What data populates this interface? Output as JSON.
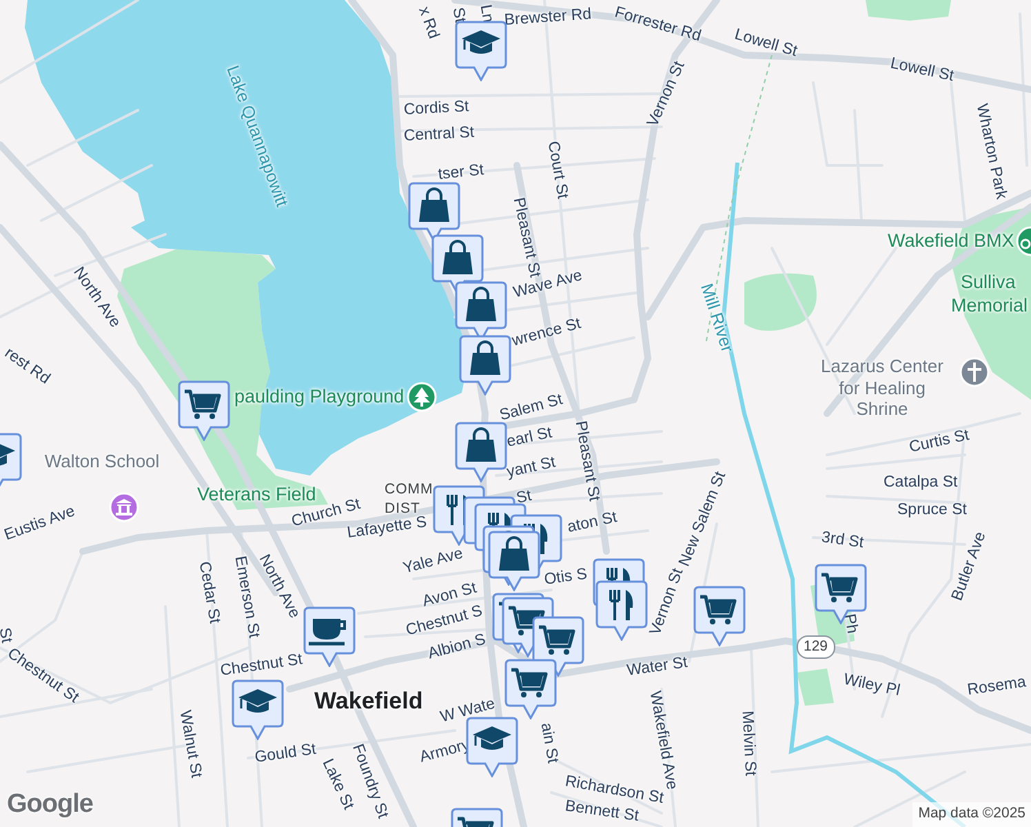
{
  "map": {
    "labels": [
      {
        "kind": "street",
        "text": "x Rd"
      },
      {
        "kind": "street",
        "text": "St"
      },
      {
        "kind": "street",
        "text": "Ln"
      },
      {
        "kind": "street",
        "text": "Brewster Rd"
      },
      {
        "kind": "street",
        "text": "Forrester Rd"
      },
      {
        "kind": "street",
        "text": "Lowell St"
      },
      {
        "kind": "street",
        "text": "Lowell St"
      },
      {
        "kind": "water",
        "text": "Lake Quannapowitt"
      },
      {
        "kind": "street",
        "text": "Vernon St"
      },
      {
        "kind": "street",
        "text": "Cordis St"
      },
      {
        "kind": "street",
        "text": "Central St"
      },
      {
        "kind": "street",
        "text": "Court St"
      },
      {
        "kind": "street",
        "text": "Wharton Park"
      },
      {
        "kind": "street",
        "text": "tser St"
      },
      {
        "kind": "street",
        "text": "Pleasant St"
      },
      {
        "kind": "park",
        "text": "Wakefield BMX"
      },
      {
        "kind": "park",
        "text": "Sulliva"
      },
      {
        "kind": "park",
        "text": "Memorial"
      },
      {
        "kind": "street",
        "text": "North Ave"
      },
      {
        "kind": "street",
        "text": "Wave Ave"
      },
      {
        "kind": "water",
        "text": "Mill River"
      },
      {
        "kind": "street",
        "text": "wrence St"
      },
      {
        "kind": "street",
        "text": "rest Rd"
      },
      {
        "kind": "park",
        "text": "paulding Playground"
      },
      {
        "kind": "place",
        "text": "Lazarus Center for Healing Shrine"
      },
      {
        "kind": "street",
        "text": "Salem St"
      },
      {
        "kind": "street",
        "text": "Pleasant St"
      },
      {
        "kind": "place",
        "text": "Walton School"
      },
      {
        "kind": "street",
        "text": "earl St"
      },
      {
        "kind": "street",
        "text": "Curtis St"
      },
      {
        "kind": "street",
        "text": "yant St"
      },
      {
        "kind": "street",
        "text": "New Salem St"
      },
      {
        "kind": "street",
        "text": "Catalpa St"
      },
      {
        "kind": "district",
        "text": "COMM"
      },
      {
        "kind": "district",
        "text": "DIST"
      },
      {
        "kind": "park",
        "text": "Veterans Field"
      },
      {
        "kind": "street",
        "text": "St"
      },
      {
        "kind": "street",
        "text": "Spruce St"
      },
      {
        "kind": "street",
        "text": "Church St"
      },
      {
        "kind": "street",
        "text": "Eustis Ave"
      },
      {
        "kind": "street",
        "text": "aton St"
      },
      {
        "kind": "street",
        "text": "Lafayette S"
      },
      {
        "kind": "street",
        "text": "3rd St"
      },
      {
        "kind": "street",
        "text": "Yale Ave"
      },
      {
        "kind": "street",
        "text": "Cedar St"
      },
      {
        "kind": "street",
        "text": "Emerson St"
      },
      {
        "kind": "street",
        "text": "North Ave"
      },
      {
        "kind": "street",
        "text": "Butler Ave"
      },
      {
        "kind": "street",
        "text": "Otis S"
      },
      {
        "kind": "street",
        "text": "Avon St"
      },
      {
        "kind": "street",
        "text": "Vernon St"
      },
      {
        "kind": "street",
        "text": "Chestnut S"
      },
      {
        "kind": "street",
        "text": "St"
      },
      {
        "kind": "street",
        "text": "Chestnut St"
      },
      {
        "kind": "street",
        "text": "Albion S"
      },
      {
        "kind": "street",
        "text": "Ph"
      },
      {
        "kind": "shield",
        "text": "129"
      },
      {
        "kind": "street",
        "text": "Water St"
      },
      {
        "kind": "street",
        "text": "Chestnut St"
      },
      {
        "kind": "street",
        "text": "Wiley Pl"
      },
      {
        "kind": "street",
        "text": "Rosema"
      },
      {
        "kind": "city",
        "text": "Wakefield"
      },
      {
        "kind": "street",
        "text": "W Wate"
      },
      {
        "kind": "street",
        "text": "Wakefield Ave"
      },
      {
        "kind": "street",
        "text": "ain St"
      },
      {
        "kind": "street",
        "text": "Melvin St"
      },
      {
        "kind": "street",
        "text": "Walnut St"
      },
      {
        "kind": "street",
        "text": "Armory"
      },
      {
        "kind": "street",
        "text": "Gould St"
      },
      {
        "kind": "street",
        "text": "Foundry St"
      },
      {
        "kind": "street",
        "text": "Richardson St"
      },
      {
        "kind": "street",
        "text": "Lake St"
      },
      {
        "kind": "street",
        "text": "Bennett St"
      }
    ]
  },
  "attribution": {
    "logo": "Google",
    "text": "Map data ©2025"
  }
}
